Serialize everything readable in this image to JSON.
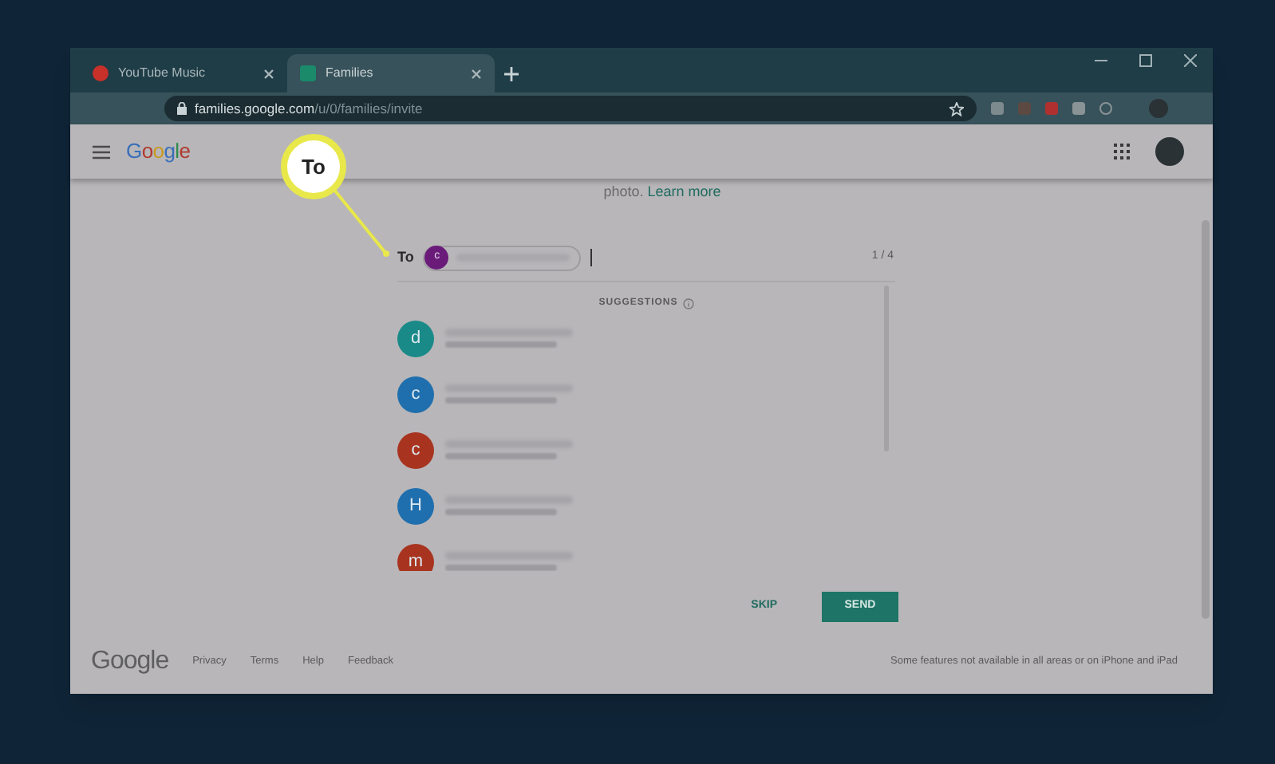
{
  "browser": {
    "tabs": [
      {
        "title": "YouTube Music",
        "kind": "music",
        "selected": false
      },
      {
        "title": "Families",
        "kind": "families",
        "selected": true
      }
    ],
    "url": {
      "domain": "families.google.com",
      "path": "/u/0/families/invite"
    }
  },
  "header": {
    "logo": "Google"
  },
  "callout": {
    "label": "To"
  },
  "intro": {
    "text": "photo.",
    "link": "Learn more"
  },
  "recipients": {
    "label": "To",
    "chips": [
      {
        "initial": "c",
        "color": "#6a1b7a"
      }
    ],
    "count": "1 / 4"
  },
  "suggestions": {
    "title": "SUGGESTIONS",
    "items": [
      {
        "initial": "d",
        "color": "#1a8a88"
      },
      {
        "initial": "c",
        "color": "#1f6fae"
      },
      {
        "initial": "c",
        "color": "#a8341f"
      },
      {
        "initial": "H",
        "color": "#1f6fae"
      },
      {
        "initial": "m",
        "color": "#a8341f"
      }
    ]
  },
  "actions": {
    "skip": "SKIP",
    "send": "SEND"
  },
  "footer": {
    "logo": "Google",
    "links": [
      "Privacy",
      "Terms",
      "Help",
      "Feedback"
    ],
    "note": "Some features not available in all areas or on iPhone and iPad"
  }
}
